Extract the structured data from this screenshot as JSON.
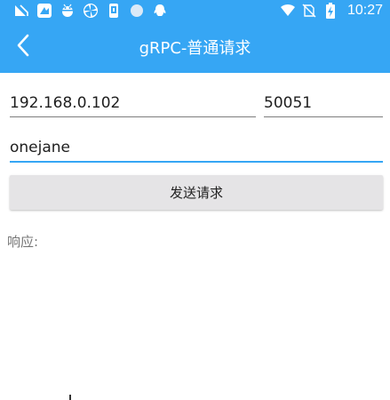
{
  "status_bar": {
    "time": "10:27",
    "left_icons": [
      "signal-app-icon",
      "wechat-work-icon",
      "android-debug-icon",
      "pinwheel-app-icon",
      "phone-notify-icon",
      "circle-dot-icon",
      "qq-icon"
    ],
    "right_icons": [
      "wifi-icon",
      "no-sim-icon",
      "battery-charging-icon"
    ]
  },
  "app_bar": {
    "title": "gRPC-普通请求",
    "back_icon": "back-arrow-icon"
  },
  "form": {
    "host_value": "192.168.0.102",
    "port_value": "50051",
    "name_value": "onejane"
  },
  "actions": {
    "send_label": "发送请求"
  },
  "response": {
    "label": "响应:"
  },
  "colors": {
    "primary": "#36a6f4",
    "button_bg": "#e5e4e6",
    "hint_text": "#777777"
  }
}
